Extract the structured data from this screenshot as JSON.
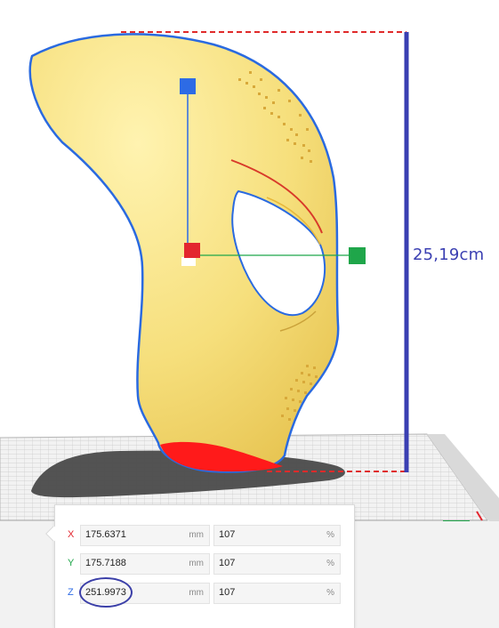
{
  "viewport": {
    "height_annotation": "25,19cm",
    "colors": {
      "model_fill": "#f6df7c",
      "model_outline": "#2a6ae0",
      "overhang": "#ff0000",
      "annotation": "#3a3fb2",
      "gizmo_x": "#e3262f",
      "gizmo_y": "#2d6be5",
      "gizmo_z": "#1fa64a"
    },
    "icons": [
      "move-gizmo-x-handle",
      "move-gizmo-y-handle",
      "move-gizmo-z-handle"
    ]
  },
  "scale_panel": {
    "rows": [
      {
        "axis": "X",
        "axis_color": "#e3262f",
        "value": "175.6371",
        "unit": "mm",
        "percent": "107",
        "percent_unit": "%"
      },
      {
        "axis": "Y",
        "axis_color": "#1fa64a",
        "value": "175.7188",
        "unit": "mm",
        "percent": "107",
        "percent_unit": "%"
      },
      {
        "axis": "Z",
        "axis_color": "#2d6be5",
        "value": "251.9973",
        "unit": "mm",
        "percent": "107",
        "percent_unit": "%"
      }
    ]
  }
}
